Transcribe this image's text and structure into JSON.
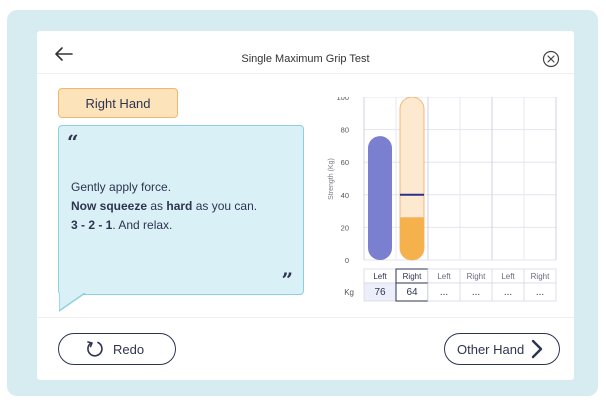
{
  "header": {
    "title": "Single Maximum Grip Test"
  },
  "icons": {
    "back": "arrow-left-icon",
    "close": "close-circle-icon",
    "redo": "redo-icon",
    "next": "chevron-right-icon"
  },
  "hand_tag": "Right Hand",
  "instruction": {
    "open_quote": "“",
    "close_quote": "”",
    "line1": "Gently apply force.",
    "line2_bold1": "Now squeeze",
    "line2_text1": " as ",
    "line2_bold2": "hard",
    "line2_text2": " as you can.",
    "line3_bold": "3 - 2 - 1",
    "line3_text": ". And relax."
  },
  "colors": {
    "left_bar": "#7b7fd0",
    "right_bar_fill": "#f5b14c",
    "right_bar_track": "#fde9cf",
    "right_bar_border": "#f0b878",
    "target_line": "#2d2f8f",
    "bubble_bg": "#d9f1f6",
    "bubble_border": "#8dd0dc",
    "frame_bg": "#d6ecf1"
  },
  "chart_data": {
    "type": "bar",
    "ylabel": "Strength (Kg)",
    "ylim": [
      0,
      100
    ],
    "yticks": [
      "0",
      "20",
      "40",
      "60",
      "80",
      "100"
    ],
    "categories": [
      "Left",
      "Right",
      "Left",
      "Right",
      "Left",
      "Right"
    ],
    "values_label": "Kg",
    "values": [
      "76",
      "64",
      "...",
      "...",
      "...",
      "..."
    ],
    "bars": {
      "left_value": 76,
      "right_value": 26,
      "right_target": 40
    },
    "selected_column": 1,
    "grid": true
  },
  "buttons": {
    "redo": "Redo",
    "other_hand": "Other Hand"
  }
}
